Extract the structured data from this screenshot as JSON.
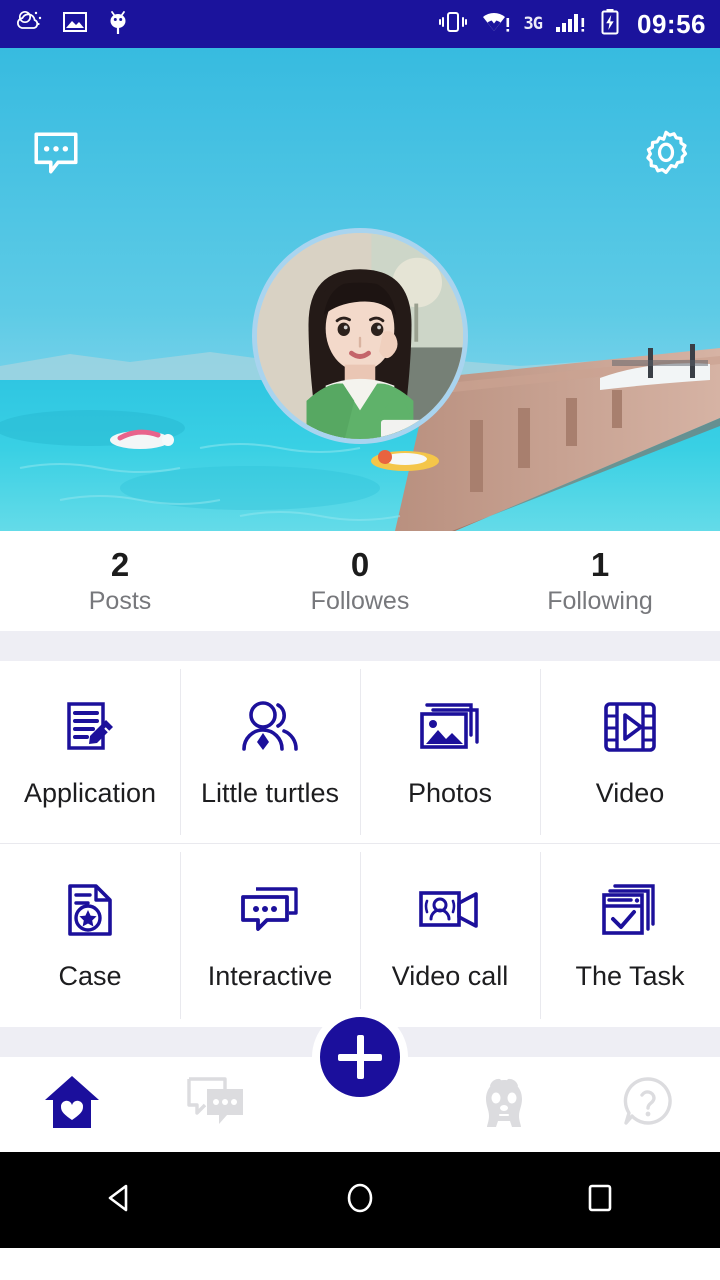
{
  "status_bar": {
    "time": "09:56",
    "network_type": "3G",
    "left_icons": [
      "weather-cloud-sun-icon",
      "gallery-image-icon",
      "android-bug-icon"
    ],
    "right_icons": [
      "vibrate-icon",
      "wifi-alert-icon",
      "signal-bars-alert-icon",
      "battery-charging-icon"
    ],
    "bg_color": "#1b139c"
  },
  "cover": {
    "message_icon": "message-bubble-icon",
    "settings_icon": "gear-icon",
    "avatar_alt": "profile-photo",
    "sky_color": "#39bede",
    "water_color": "#35c9e0"
  },
  "stats": [
    {
      "value": "2",
      "label": "Posts",
      "name": "posts"
    },
    {
      "value": "0",
      "label": "Followes",
      "name": "followers"
    },
    {
      "value": "1",
      "label": "Following",
      "name": "following"
    }
  ],
  "grid": {
    "accent_color": "#1c109b",
    "rows": [
      [
        {
          "label": "Application",
          "icon": "document-pencil-icon"
        },
        {
          "label": "Little turtles",
          "icon": "two-people-icon"
        },
        {
          "label": "Photos",
          "icon": "photo-stack-icon"
        },
        {
          "label": "Video",
          "icon": "film-play-icon"
        }
      ],
      [
        {
          "label": "Case",
          "icon": "document-star-icon"
        },
        {
          "label": "Interactive",
          "icon": "chat-bubbles-icon"
        },
        {
          "label": "Video call",
          "icon": "video-camera-people-icon"
        },
        {
          "label": "The Task",
          "icon": "window-check-icon"
        }
      ]
    ]
  },
  "bottom_nav": {
    "active_color": "#1b0f9c",
    "inactive_color": "#dcdcdf",
    "items": [
      {
        "icon": "home-heart-icon",
        "active": true
      },
      {
        "icon": "chat-bubbles-icon",
        "active": false
      },
      {
        "icon": "plus-icon",
        "active": false
      },
      {
        "icon": "panda-icon",
        "active": false
      },
      {
        "icon": "question-bubble-icon",
        "active": false
      }
    ]
  },
  "android_nav": {
    "back_icon": "back-triangle-icon",
    "home_icon": "home-circle-icon",
    "recents_icon": "recents-square-icon"
  }
}
